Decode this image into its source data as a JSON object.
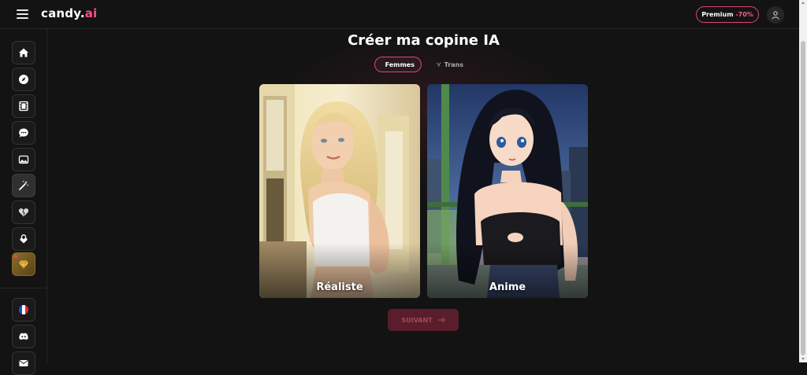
{
  "header": {
    "logo_main": "candy.",
    "logo_accent": "ai",
    "premium_label": "Premium",
    "premium_discount": "-70%"
  },
  "sidebar": {
    "items": [
      {
        "icon": "home-icon"
      },
      {
        "icon": "compass-icon"
      },
      {
        "icon": "film-icon"
      },
      {
        "icon": "chat-icon"
      },
      {
        "icon": "image-icon"
      },
      {
        "icon": "magic-wand-icon",
        "active": true
      },
      {
        "icon": "heart-icon"
      },
      {
        "icon": "lock-icon"
      },
      {
        "icon": "gem-icon"
      }
    ],
    "bottom_items": [
      {
        "icon": "french-flag-icon"
      },
      {
        "icon": "discord-icon"
      },
      {
        "icon": "mail-icon"
      }
    ]
  },
  "main": {
    "title": "Créer ma copine IA",
    "tabs": [
      {
        "label": "Femmes",
        "selected": true
      },
      {
        "label": "Trans",
        "selected": false
      }
    ],
    "cards": [
      {
        "label": "Réaliste"
      },
      {
        "label": "Anime"
      }
    ],
    "next_label": "SUIVANT"
  },
  "colors": {
    "accent": "#e0466f",
    "background": "#131313"
  }
}
